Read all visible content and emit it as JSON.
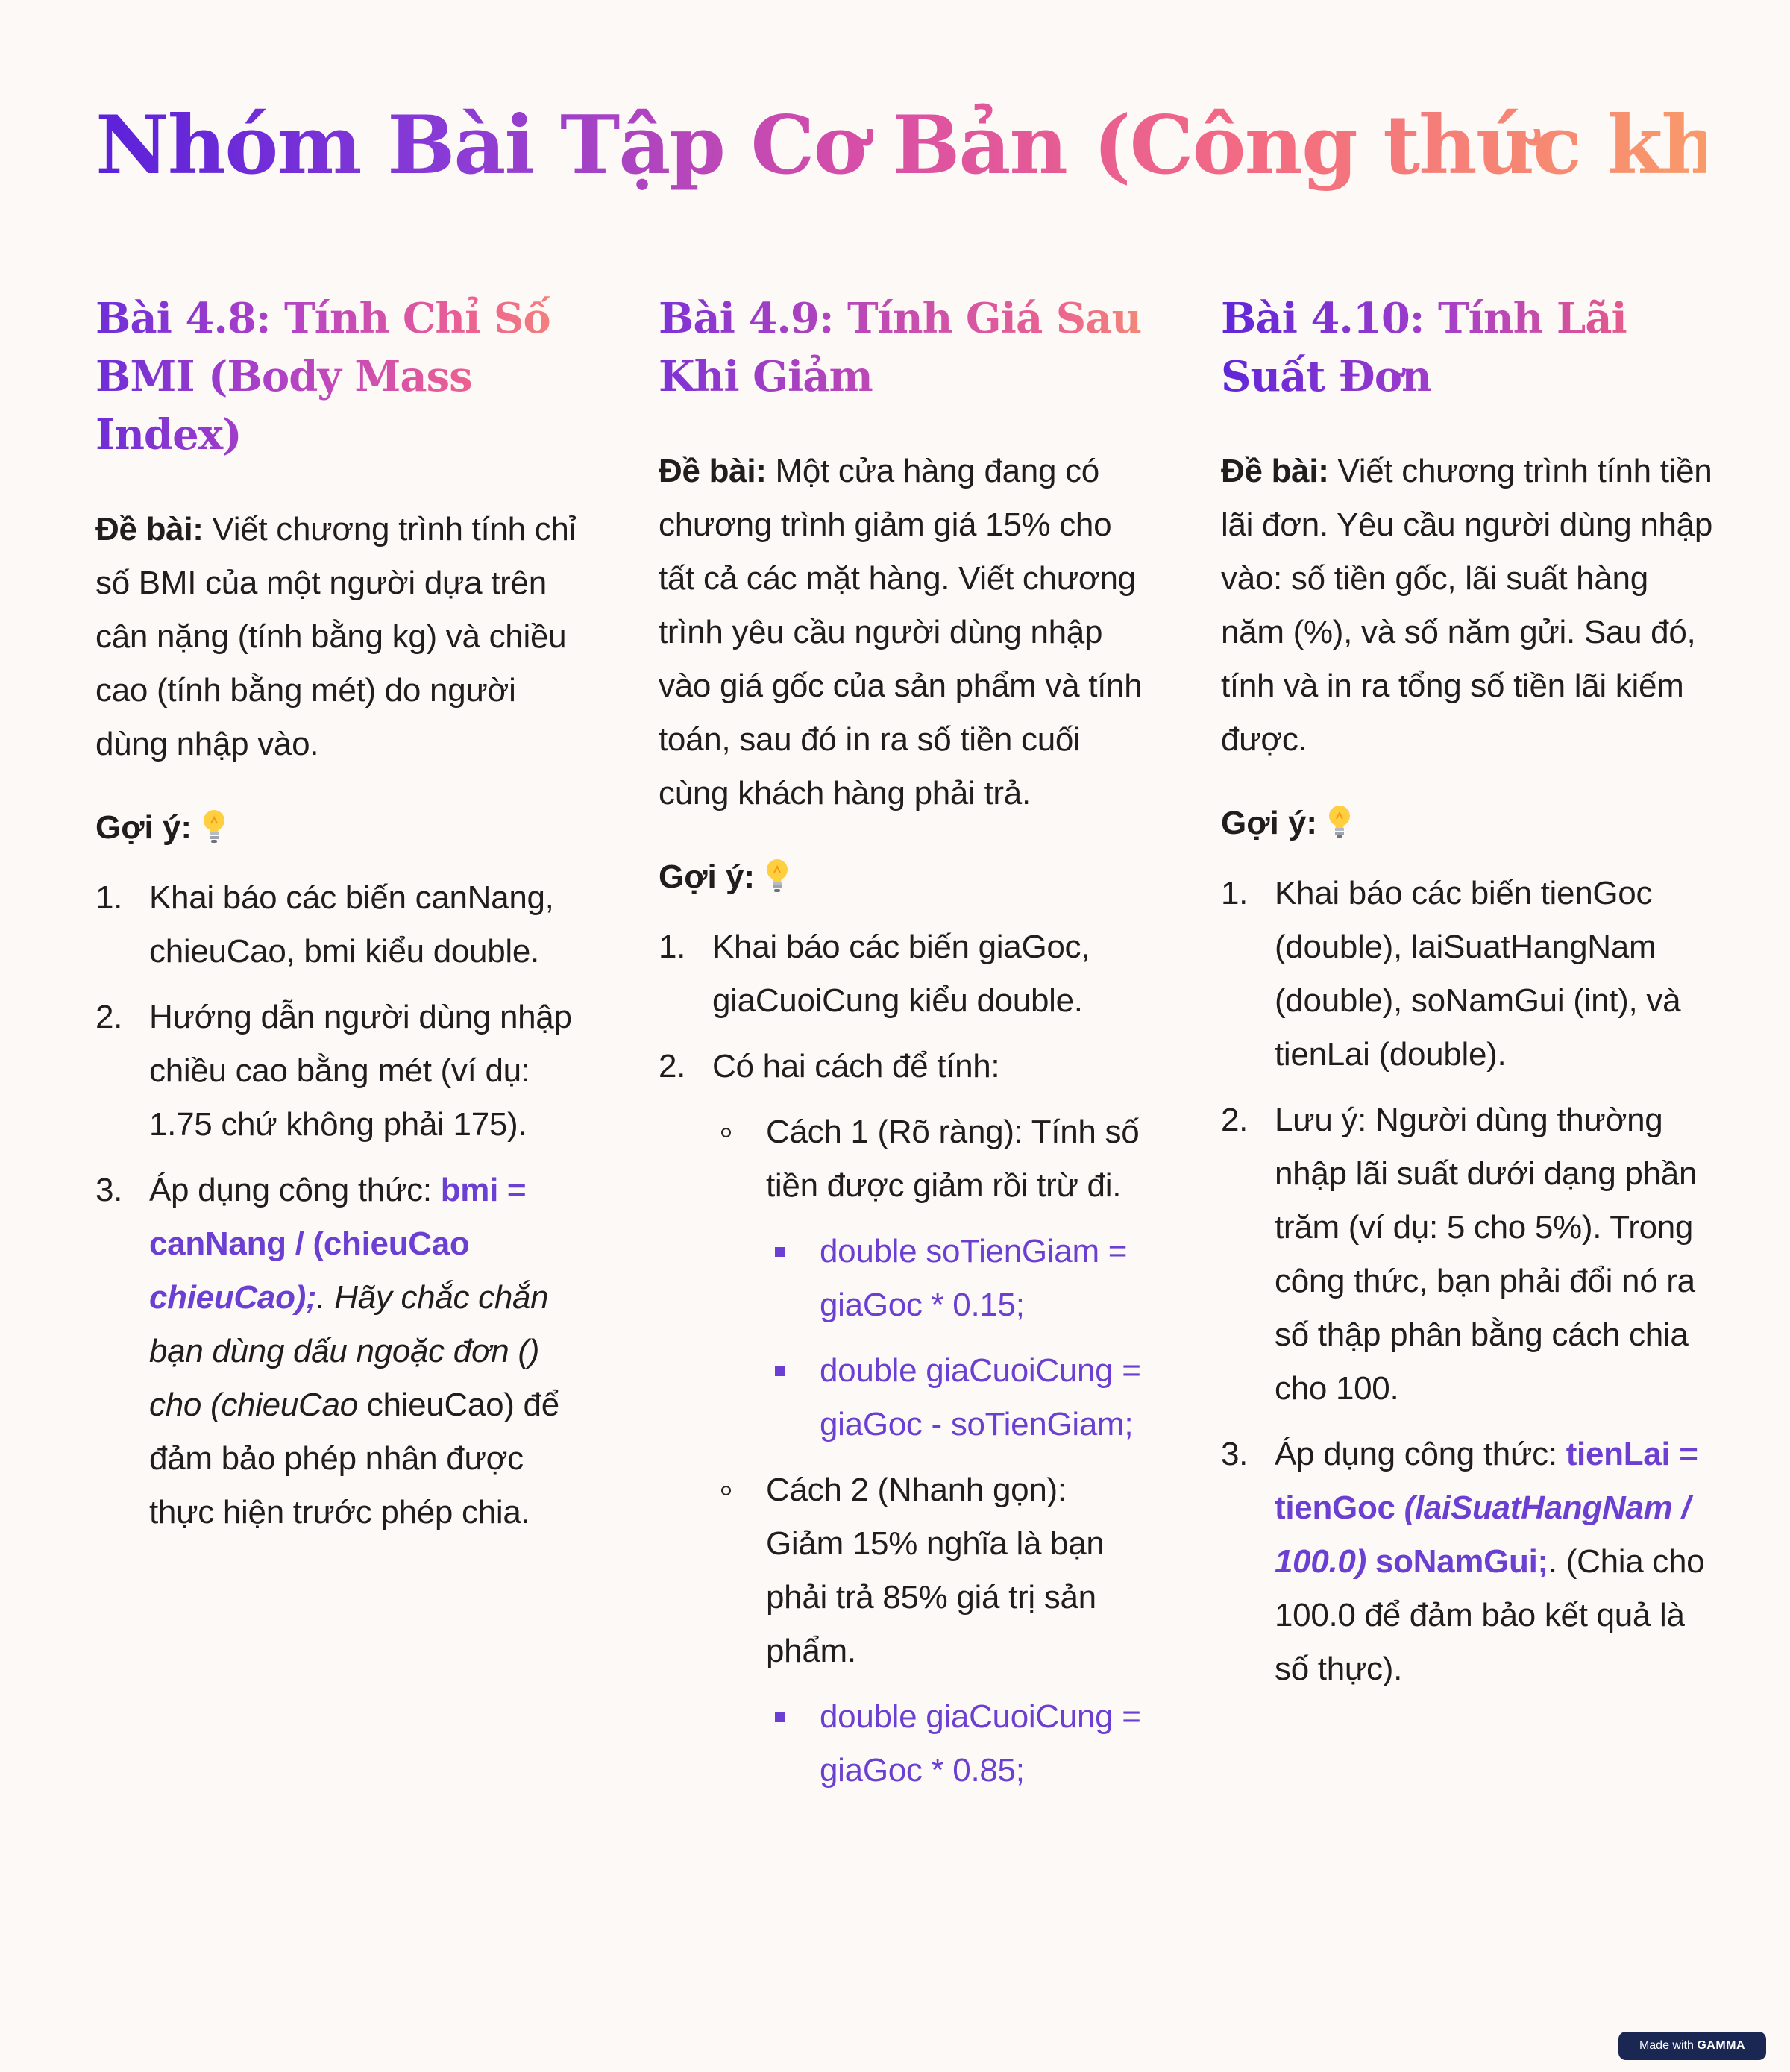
{
  "title": "Nhóm Bài Tập Cơ Bản (Công thức khác)",
  "columns": [
    {
      "heading": "Bài 4.8: Tính Chỉ Số BMI (Body Mass Index)",
      "problem_label": "Đề bài:",
      "problem_text": " Viết chương trình tính chỉ số BMI của một người dựa trên cân nặng (tính bằng kg) và chiều cao (tính bằng mét) do người dùng nhập vào.",
      "hint_label": "Gợi ý:",
      "steps": [
        {
          "num": "1.",
          "text": "Khai báo các biến canNang, chieuCao, bmi kiểu double."
        },
        {
          "num": "2.",
          "text": "Hướng dẫn người dùng nhập chiều cao bằng mét (ví dụ: 1.75 chứ không phải 175)."
        },
        {
          "num": "3.",
          "p1": "Áp dụng công thức: ",
          "p2": "bmi = canNang / (chieuCao",
          "p3": " chieuCao);",
          "p4": ". Hãy chắc chắn bạn dùng dấu ngoặc đơn () cho (chieuCao",
          "p5": " chieuCao) để đảm bảo phép nhân được thực hiện trước phép chia."
        }
      ]
    },
    {
      "heading": "Bài 4.9: Tính Giá Sau Khi Giảm",
      "problem_label": "Đề bài:",
      "problem_text": " Một cửa hàng đang có chương trình giảm giá 15% cho tất cả các mặt hàng. Viết chương trình yêu cầu người dùng nhập vào giá gốc của sản phẩm và tính toán, sau đó in ra số tiền cuối cùng khách hàng phải trả.",
      "hint_label": "Gợi ý:",
      "steps": [
        {
          "num": "1.",
          "text": "Khai báo các biến giaGoc, giaCuoiCung kiểu double."
        },
        {
          "num": "2.",
          "text": "Có hai cách để tính:"
        }
      ],
      "methods": [
        {
          "text": "Cách 1 (Rõ ràng): Tính số tiền được giảm rồi trừ đi.",
          "code": [
            "double soTienGiam = giaGoc * 0.15;",
            "double giaCuoiCung = giaGoc - soTienGiam;"
          ]
        },
        {
          "text": "Cách 2 (Nhanh gọn): Giảm 15% nghĩa là bạn phải trả 85% giá trị sản phẩm.",
          "code": [
            "double giaCuoiCung = giaGoc * 0.85;"
          ]
        }
      ]
    },
    {
      "heading": "Bài 4.10: Tính Lãi Suất Đơn",
      "problem_label": "Đề bài:",
      "problem_text": " Viết chương trình tính tiền lãi đơn. Yêu cầu người dùng nhập vào: số tiền gốc, lãi suất hàng năm (%), và số năm gửi. Sau đó, tính và in ra tổng số tiền lãi kiếm được.",
      "hint_label": "Gợi ý:",
      "steps": [
        {
          "num": "1.",
          "text": "Khai báo các biến tienGoc (double), laiSuatHangNam (double), soNamGui (int), và tienLai (double)."
        },
        {
          "num": "2.",
          "text": "Lưu ý: Người dùng thường nhập lãi suất dưới dạng phần trăm (ví dụ: 5 cho 5%). Trong công thức, bạn phải đổi nó ra số thập phân bằng cách chia cho 100."
        },
        {
          "num": "3.",
          "p1": "Áp dụng công thức: ",
          "p2": "tienLai = tienGoc",
          "p3": " (laiSuatHangNam / 100.0)",
          "p4": " soNamGui;",
          "p5": ". (Chia cho 100.0 để đảm bảo kết quả là số thực)."
        }
      ]
    }
  ],
  "badge": {
    "prefix": "Made with",
    "brand": "GAMMA"
  },
  "colors": {
    "background": "#fdf9f6",
    "accent": "#6b3fd2",
    "gradient_start": "#5b21d9",
    "gradient_end": "#f99a6a",
    "badge_bg": "#1a2752"
  },
  "icons": {
    "hint": "lightbulb-icon",
    "bullet_level2": "hollow-circle",
    "bullet_level3": "filled-square"
  }
}
